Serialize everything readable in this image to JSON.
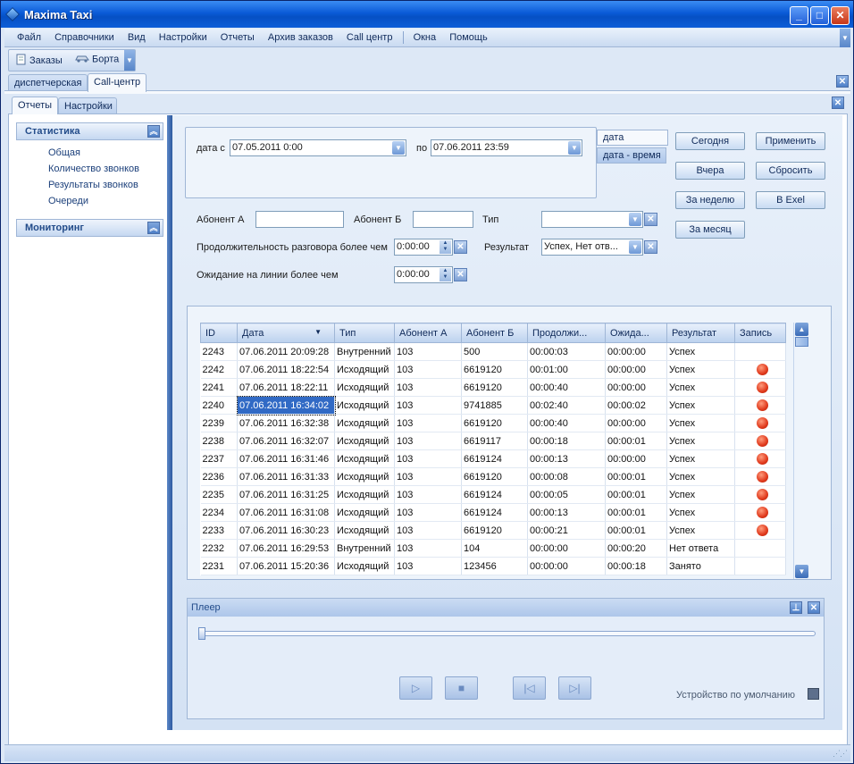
{
  "window": {
    "title": "Maxima Taxi",
    "min": "_",
    "max": "□",
    "close": "✕"
  },
  "menu": [
    "Файл",
    "Справочники",
    "Вид",
    "Настройки",
    "Отчеты",
    "Архив заказов",
    "Call центр",
    "Окна",
    "Помощь"
  ],
  "toolbar": {
    "orders": "Заказы",
    "boards": "Борта"
  },
  "main_tabs": [
    "диспетчерская",
    "Call-центр"
  ],
  "sub_tabs": [
    "Отчеты",
    "Настройки"
  ],
  "sidebar": {
    "statistics": {
      "title": "Статистика",
      "items": [
        "Общая",
        "Количество звонков",
        "Результаты звонков",
        "Очереди"
      ]
    },
    "monitoring": {
      "title": "Мониторинг"
    }
  },
  "filters": {
    "date_from_label": "дата с",
    "date_from": "07.05.2011 0:00",
    "date_to_label": "по",
    "date_to": "07.06.2011 23:59",
    "mode_tabs": [
      "дата",
      "дата - время"
    ],
    "subscriber_a_label": "Абонент А",
    "subscriber_a": "",
    "subscriber_b_label": "Абонент Б",
    "subscriber_b": "",
    "type_label": "Тип",
    "type_value": "",
    "duration_label": "Продолжительность разговора более чем",
    "duration_value": "0:00:00",
    "result_label": "Результат",
    "result_value": "Успех, Нет отв...",
    "wait_label": "Ожидание на линии более чем",
    "wait_value": "0:00:00"
  },
  "buttons": {
    "today": "Сегодня",
    "yesterday": "Вчера",
    "week": "За неделю",
    "month": "За месяц",
    "apply": "Применить",
    "reset": "Сбросить",
    "excel": "В Exel"
  },
  "table": {
    "columns": [
      "ID",
      "Дата",
      "Тип",
      "Абонент А",
      "Абонент Б",
      "Продолжи...",
      "Ожида...",
      "Результат",
      "Запись"
    ],
    "rows": [
      [
        "2243",
        "07.06.2011 20:09:28",
        "Внутренний",
        "103",
        "500",
        "00:00:03",
        "00:00:00",
        "Успех",
        ""
      ],
      [
        "2242",
        "07.06.2011 18:22:54",
        "Исходящий",
        "103",
        "6619120",
        "00:01:00",
        "00:00:00",
        "Успех",
        "rec"
      ],
      [
        "2241",
        "07.06.2011 18:22:11",
        "Исходящий",
        "103",
        "6619120",
        "00:00:40",
        "00:00:00",
        "Успех",
        "rec"
      ],
      [
        "2240",
        "07.06.2011 16:34:02",
        "Исходящий",
        "103",
        "9741885",
        "00:02:40",
        "00:00:02",
        "Успех",
        "rec"
      ],
      [
        "2239",
        "07.06.2011 16:32:38",
        "Исходящий",
        "103",
        "6619120",
        "00:00:40",
        "00:00:00",
        "Успех",
        "rec"
      ],
      [
        "2238",
        "07.06.2011 16:32:07",
        "Исходящий",
        "103",
        "6619117",
        "00:00:18",
        "00:00:01",
        "Успех",
        "rec"
      ],
      [
        "2237",
        "07.06.2011 16:31:46",
        "Исходящий",
        "103",
        "6619124",
        "00:00:13",
        "00:00:00",
        "Успех",
        "rec"
      ],
      [
        "2236",
        "07.06.2011 16:31:33",
        "Исходящий",
        "103",
        "6619120",
        "00:00:08",
        "00:00:01",
        "Успех",
        "rec"
      ],
      [
        "2235",
        "07.06.2011 16:31:25",
        "Исходящий",
        "103",
        "6619124",
        "00:00:05",
        "00:00:01",
        "Успех",
        "rec"
      ],
      [
        "2234",
        "07.06.2011 16:31:08",
        "Исходящий",
        "103",
        "6619124",
        "00:00:13",
        "00:00:01",
        "Успех",
        "rec"
      ],
      [
        "2233",
        "07.06.2011 16:30:23",
        "Исходящий",
        "103",
        "6619120",
        "00:00:21",
        "00:00:01",
        "Успех",
        "rec"
      ],
      [
        "2232",
        "07.06.2011 16:29:53",
        "Внутренний",
        "103",
        "104",
        "00:00:00",
        "00:00:20",
        "Нет ответа",
        ""
      ],
      [
        "2231",
        "07.06.2011 15:20:36",
        "Исходящий",
        "103",
        "123456",
        "00:00:00",
        "00:00:18",
        "Занято",
        ""
      ]
    ]
  },
  "player": {
    "title": "Плеер",
    "device": "Устройство по умолчанию",
    "position": 0
  }
}
